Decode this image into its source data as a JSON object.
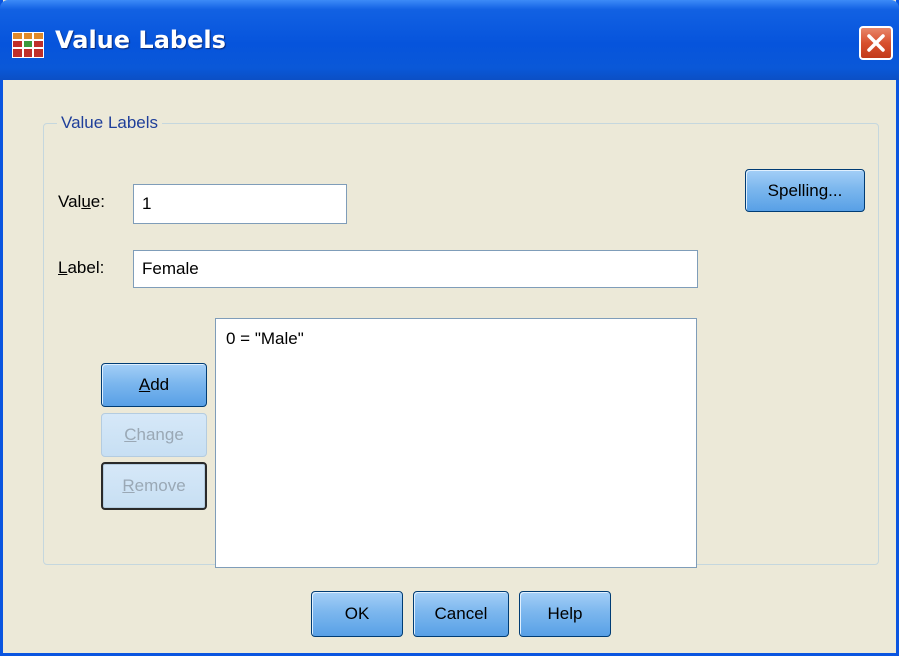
{
  "window": {
    "title": "Value Labels",
    "close_icon": "close-x-icon",
    "app_icon": "spss-grid-icon"
  },
  "group": {
    "title": "Value Labels"
  },
  "value_field": {
    "label_pre": "Val",
    "label_mnemonic": "u",
    "label_post": "e:",
    "value": "1"
  },
  "label_field": {
    "label_mnemonic": "L",
    "label_post": "abel:",
    "value": "Female"
  },
  "buttons": {
    "spelling": "Spelling...",
    "add_mnemonic": "A",
    "add_rest": "dd",
    "change_mnemonic": "C",
    "change_rest": "hange",
    "remove_mnemonic": "R",
    "remove_rest": "emove",
    "ok": "OK",
    "cancel": "Cancel",
    "help": "Help"
  },
  "labels_list": {
    "items": [
      "0 = \"Male\""
    ]
  },
  "colors": {
    "titlebar": "#0654DC",
    "dialog_bg": "#ECE9D8",
    "button_blue": "#7CB7EE",
    "close_red": "#D8502E"
  }
}
